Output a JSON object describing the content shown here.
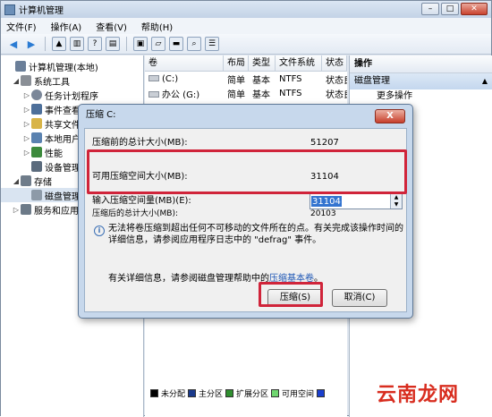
{
  "window": {
    "title": "计算机管理",
    "min": "–",
    "max": "□",
    "close": "✕"
  },
  "menu": [
    "文件(F)",
    "操作(A)",
    "查看(V)",
    "帮助(H)"
  ],
  "tree": [
    {
      "label": "计算机管理(本地)",
      "level": 0,
      "exp": "",
      "color": "#6b7f99"
    },
    {
      "label": "系统工具",
      "level": 1,
      "exp": "◢",
      "color": "#8a8f96"
    },
    {
      "label": "任务计划程序",
      "level": 2,
      "exp": "▷",
      "color": "#7b8799"
    },
    {
      "label": "事件查看器",
      "level": 2,
      "exp": "▷",
      "color": "#4d6f9a"
    },
    {
      "label": "共享文件夹",
      "level": 2,
      "exp": "▷",
      "color": "#d8b448"
    },
    {
      "label": "本地用户和组",
      "level": 2,
      "exp": "▷",
      "color": "#5a82b0"
    },
    {
      "label": "性能",
      "level": 2,
      "exp": "▷",
      "color": "#3c8a3c"
    },
    {
      "label": "设备管理器",
      "level": 2,
      "exp": "",
      "color": "#5b6b7d"
    },
    {
      "label": "存储",
      "level": 1,
      "exp": "◢",
      "color": "#6f7c8a"
    },
    {
      "label": "磁盘管理",
      "level": 2,
      "exp": "",
      "color": "#8d9aa8"
    },
    {
      "label": "服务和应用程序",
      "level": 1,
      "exp": "▷",
      "color": "#6c7a88"
    }
  ],
  "list": {
    "columns": [
      "卷",
      "布局",
      "类型",
      "文件系统",
      "状态"
    ],
    "rows": [
      {
        "vol": "(C:)",
        "layout": "简单",
        "type": "基本",
        "fs": "NTFS",
        "status": "状态良好"
      },
      {
        "vol": "办公 (G:)",
        "layout": "简单",
        "type": "基本",
        "fs": "NTFS",
        "status": "状态良好"
      }
    ],
    "legend": [
      {
        "label": "未分配",
        "color": "#000000"
      },
      {
        "label": "主分区",
        "color": "#1a3a8c"
      },
      {
        "label": "扩展分区",
        "color": "#2f8f2f"
      },
      {
        "label": "可用空间",
        "color": "#6fd66f"
      },
      {
        "label": "",
        "color": "#1a3fcf"
      }
    ]
  },
  "actions": {
    "header": "操作",
    "section": "磁盘管理",
    "items": [
      "更多操作"
    ]
  },
  "dialog": {
    "title": "压缩 C:",
    "close": "X",
    "fields": [
      {
        "label": "压缩前的总计大小(MB):",
        "value": "51207"
      },
      {
        "label": "可用压缩空间大小(MB):",
        "value": "31104"
      },
      {
        "label": "输入压缩空间量(MB)(E):",
        "value": "31104"
      },
      {
        "label": "压缩后的总计大小(MB):",
        "value": "20103"
      }
    ],
    "info_icon": "i",
    "info": "无法将卷压缩到超出任何不可移动的文件所在的点。有关完成该操作时间的详细信息，请参阅应用程序日志中的 \"defrag\" 事件。",
    "help_prefix": "有关详细信息，请参阅磁盘管理帮助中的",
    "help_link": "压缩基本卷",
    "help_suffix": "。",
    "shrink": "压缩(S)",
    "cancel": "取消(C)"
  },
  "watermark": "云南龙网"
}
